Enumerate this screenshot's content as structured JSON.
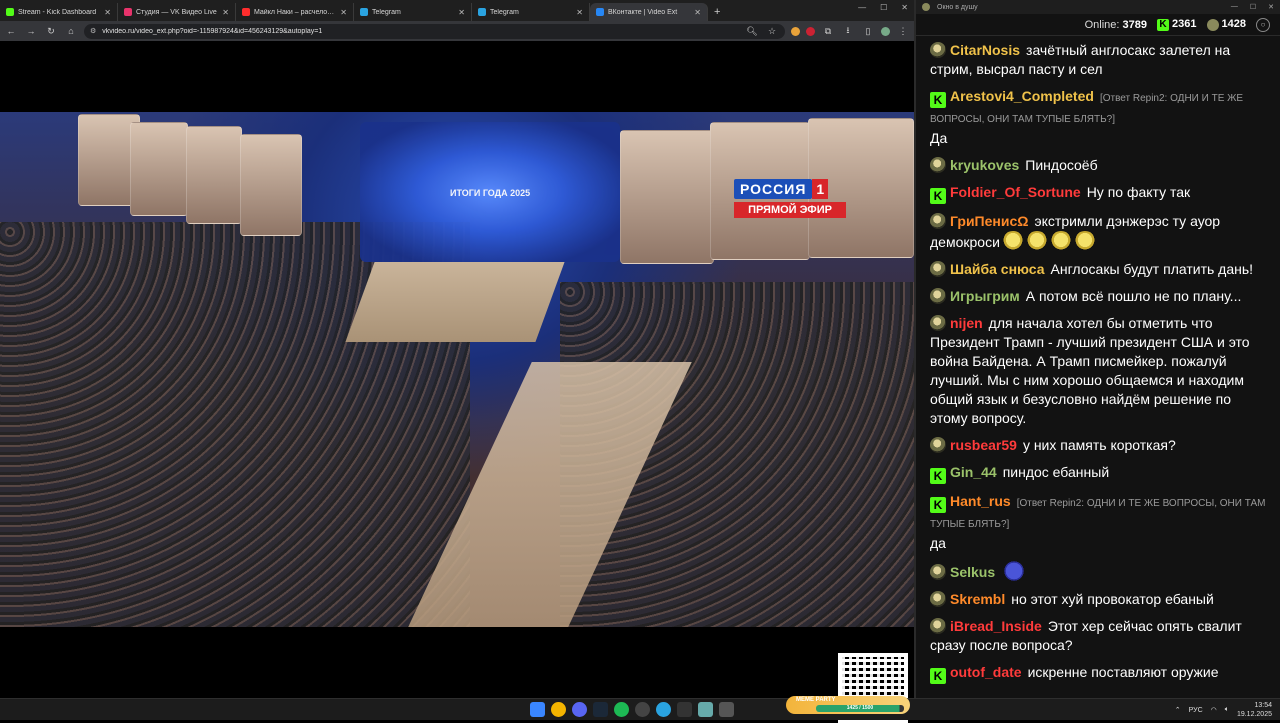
{
  "browser": {
    "tabs": [
      {
        "label": "Stream - Kick Dashboard",
        "color": "#53fc18",
        "active": false
      },
      {
        "label": "Студия — VK Видео Live",
        "color": "#e8336b",
        "active": false
      },
      {
        "label": "Майкл Наки – расчеловечени...",
        "color": "#ff2d2d",
        "active": false
      },
      {
        "label": "Telegram",
        "color": "#2aa3e0",
        "active": false
      },
      {
        "label": "Telegram",
        "color": "#2aa3e0",
        "active": false
      },
      {
        "label": "ВКонтакте | Video Ext",
        "color": "#2787f5",
        "active": true
      }
    ],
    "new_tab": "+",
    "url": "vkvideo.ru/video_ext.php?oid=-115987924&id=456243129&autoplay=1"
  },
  "video": {
    "channel": "РОССИЯ",
    "channel_num": "1",
    "live_label": "ПРЯМОЙ ЭФИР",
    "stage_title": "ИТОГИ ГОДА 2025"
  },
  "chat": {
    "window_title": "Окно в душу",
    "online_label": "Online:",
    "online_count": "3789",
    "kick_count": "2361",
    "vk_count": "1428",
    "messages": [
      {
        "nick": "CitarNosis",
        "color": "#f0c24a",
        "badge": "avatar",
        "reply": "",
        "text": "зачётный англосакс залетел на стрим, высрал пасту и сел",
        "emote": ""
      },
      {
        "nick": "Arestovi4_Completed",
        "color": "#f0c24a",
        "badge": "kick",
        "reply": "[Ответ Repin2: ОДНИ И ТЕ ЖЕ ВОПРОСЫ, ОНИ ТАМ ТУПЫЕ БЛЯТЬ?]",
        "text": "Да",
        "emote": ""
      },
      {
        "nick": "kryukoves",
        "color": "#9bc26a",
        "badge": "avatar",
        "reply": "",
        "text": "Пиндосоёб",
        "emote": ""
      },
      {
        "nick": "Foldier_Of_Sortune",
        "color": "#ff3b3b",
        "badge": "kick",
        "reply": "",
        "text": "Ну по факту так",
        "emote": ""
      },
      {
        "nick": "ГриПенисΩ",
        "color": "#ff8a2a",
        "badge": "avatar",
        "reply": "",
        "text": "экстримли дэнжерэс ту ауор демокроси",
        "emote": "yellow4"
      },
      {
        "nick": "Шайба снюса",
        "color": "#f0c24a",
        "badge": "avatar",
        "reply": "",
        "text": "Англосакы будут платить дань!",
        "emote": ""
      },
      {
        "nick": "Игрыгрим",
        "color": "#9bc26a",
        "badge": "avatar",
        "reply": "",
        "text": "А потом всё пошло не по плану...",
        "emote": ""
      },
      {
        "nick": "nijen",
        "color": "#ff3b3b",
        "badge": "avatar",
        "reply": "",
        "text": "для начала хотел бы отметить что Президент Трамп - лучший президент США и это война Байдена. А Трамп писмейкер. пожалуй лучший. Мы с ним хорошо общаемся и находим общий язык и безусловно найдём решение по этому вопросу.",
        "emote": ""
      },
      {
        "nick": "rusbear59",
        "color": "#ff3b3b",
        "badge": "avatar",
        "reply": "",
        "text": "у них память короткая?",
        "emote": ""
      },
      {
        "nick": "Gin_44",
        "color": "#9bc26a",
        "badge": "kick",
        "reply": "",
        "text": "пиндос ебанный",
        "emote": ""
      },
      {
        "nick": "Hant_rus",
        "color": "#ff8a2a",
        "badge": "kick",
        "reply": "[Ответ Repin2: ОДНИ И ТЕ ЖЕ ВОПРОСЫ, ОНИ ТАМ ТУПЫЕ БЛЯТЬ?]",
        "text": "да",
        "emote": ""
      },
      {
        "nick": "Selkus",
        "color": "#9bc26a",
        "badge": "avatar",
        "reply": "",
        "text": "",
        "emote": "blue"
      },
      {
        "nick": "Skrembl",
        "color": "#ff8a2a",
        "badge": "avatar",
        "reply": "",
        "text": "но этот хуй провокатор ебаный",
        "emote": ""
      },
      {
        "nick": "iBread_Inside",
        "color": "#ff3b3b",
        "badge": "avatar",
        "reply": "",
        "text": "Этот хер сейчас опять свалит сразу после вопроса?",
        "emote": ""
      },
      {
        "nick": "outof_date",
        "color": "#ff3b3b",
        "badge": "kick",
        "reply": "",
        "text": "искренне поставляют оружие",
        "emote": ""
      }
    ]
  },
  "taskbar": {
    "meme_title": "MEME PARTY",
    "meme_progress_text": "1425 / 1500",
    "meme_progress": 0.95,
    "lang": "РУС",
    "time": "13:54",
    "date": "19.12.2025"
  }
}
